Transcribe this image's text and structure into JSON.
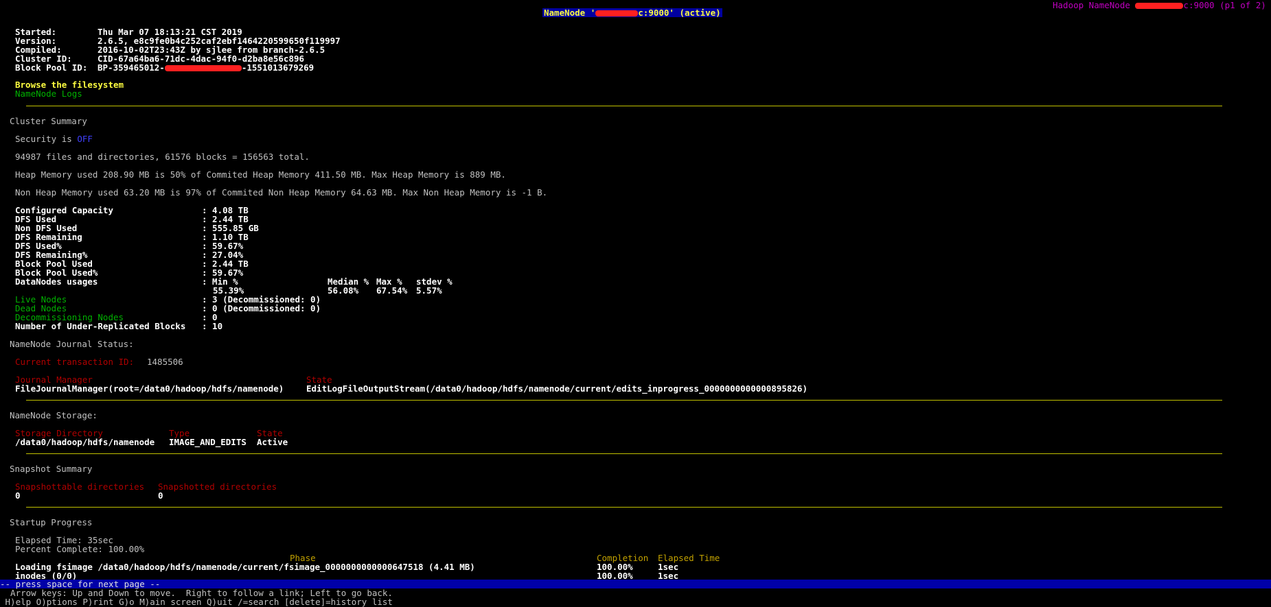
{
  "header": {
    "title_prefix": "NameNode '",
    "title_suffix": "c:9000' (active)",
    "right_prefix": "Hadoop NameNode ",
    "right_suffix": "c:9000 (p1 of 2)"
  },
  "info": [
    {
      "label": "Started:",
      "value": "Thu Mar 07 18:13:21 CST 2019"
    },
    {
      "label": "Version:",
      "value": "2.6.5, e8c9fe0b4c252caf2ebf1464220599650f119997"
    },
    {
      "label": "Compiled:",
      "value": "2016-10-02T23:43Z by sjlee from branch-2.6.5"
    },
    {
      "label": "Cluster ID:",
      "value": "CID-67a64ba6-71dc-4dac-94f0-d2ba8e56c896"
    },
    {
      "label": "Block Pool ID:",
      "value_prefix": "BP-359465012-",
      "value_suffix": "-1551013679269"
    }
  ],
  "links": {
    "browse": "Browse the filesystem",
    "logs": "NameNode Logs"
  },
  "cluster_summary": {
    "heading": "Cluster Summary",
    "security_prefix": "Security is ",
    "security_value": "OFF",
    "files_line": "94987 files and directories, 61576 blocks = 156563 total.",
    "heap_line": "Heap Memory used 208.90 MB is 50% of Commited Heap Memory 411.50 MB. Max Heap Memory is 889 MB.",
    "nonheap_line": "Non Heap Memory used 63.20 MB is 97% of Commited Non Heap Memory 64.63 MB. Max Non Heap Memory is -1 B."
  },
  "capacity": [
    {
      "label": "Configured Capacity",
      "value": ": 4.08 TB"
    },
    {
      "label": "DFS Used",
      "value": ": 2.44 TB"
    },
    {
      "label": "Non DFS Used",
      "value": ": 555.85 GB"
    },
    {
      "label": "DFS Remaining",
      "value": ": 1.10 TB"
    },
    {
      "label": "DFS Used%",
      "value": ": 59.67%"
    },
    {
      "label": "DFS Remaining%",
      "value": ": 27.04%"
    },
    {
      "label": "Block Pool Used",
      "value": ": 2.44 TB"
    },
    {
      "label": "Block Pool Used%",
      "value": ": 59.67%"
    },
    {
      "label": "DataNodes usages",
      "value": ": Min %"
    }
  ],
  "usages": {
    "min_val": "55.39%",
    "median_head": "Median %",
    "max_head": "Max %",
    "stdev_head": "stdev %",
    "median_val": "56.08%",
    "max_val": "67.54%",
    "stdev_val": "5.57%"
  },
  "nodes": [
    {
      "label": "Live Nodes",
      "value": ": 3 (Decommissioned: 0)"
    },
    {
      "label": "Dead Nodes",
      "value": ": 0 (Decommissioned: 0)"
    },
    {
      "label": "Decommissioning Nodes",
      "value": ": 0"
    },
    {
      "label": "Number of Under-Replicated Blocks",
      "value": ": 10"
    }
  ],
  "journal": {
    "heading": "NameNode Journal Status:",
    "txid_label": "Current transaction ID:",
    "txid_value": "1485506",
    "col_manager": "Journal Manager",
    "col_state": "State",
    "manager_value": "FileJournalManager(root=/data0/hadoop/hdfs/namenode)",
    "state_value": "EditLogFileOutputStream(/data0/hadoop/hdfs/namenode/current/edits_inprogress_0000000000000895826)"
  },
  "storage": {
    "heading": "NameNode Storage:",
    "col_dir": "Storage Directory",
    "col_type": "Type",
    "col_state": "State",
    "dir": "/data0/hadoop/hdfs/namenode",
    "type": "IMAGE_AND_EDITS",
    "state": "Active"
  },
  "snapshot": {
    "heading": "Snapshot Summary",
    "col1": "Snapshottable directories",
    "col2": "Snapshotted directories",
    "val1": "0",
    "val2": "0"
  },
  "startup": {
    "heading": "Startup Progress",
    "elapsed": "Elapsed Time: 35sec",
    "percent": "Percent Complete: 100.00%",
    "col_phase": "Phase",
    "col_completion": "Completion",
    "col_elapsed": "Elapsed Time",
    "row1_phase": "Loading fsimage /data0/hadoop/hdfs/namenode/current/fsimage_0000000000000647518 (4.41 MB)",
    "row1_completion": "100.00%",
    "row1_elapsed": "1sec",
    "row2_phase": "inodes (0/0)",
    "row2_completion": "100.00%",
    "row2_elapsed": "1sec"
  },
  "footer": {
    "status": "-- press space for next page --",
    "help1": "  Arrow keys: Up and Down to move.  Right to follow a link; Left to go back.",
    "help2": " H)elp O)ptions P)rint G)o M)ain screen Q)uit /=search [delete]=history list"
  },
  "colors": {
    "background": "#000000",
    "link_yellow": "#ffff40",
    "link_green": "#00b000",
    "label_red": "#b00000",
    "rule_yellow": "#c0c000",
    "status_blue": "#0000a8"
  }
}
